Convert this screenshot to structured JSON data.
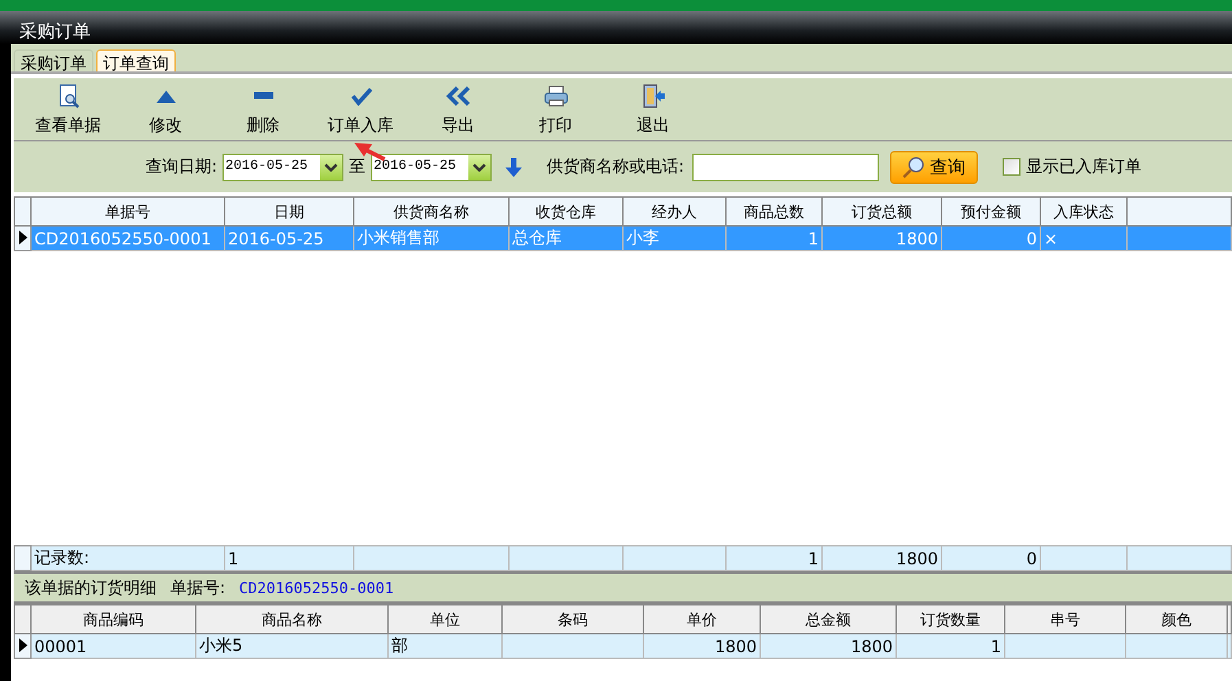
{
  "window": {
    "title": "采购订单"
  },
  "tabs": [
    {
      "label": "采购订单",
      "selected": false
    },
    {
      "label": "订单查询",
      "selected": true
    }
  ],
  "toolbar": [
    {
      "label": "查看单据",
      "kind": "view"
    },
    {
      "label": "修改",
      "kind": "edit"
    },
    {
      "label": "删除",
      "kind": "delete"
    },
    {
      "label": "订单入库",
      "kind": "check"
    },
    {
      "label": "导出",
      "kind": "export"
    },
    {
      "label": "打印",
      "kind": "print"
    },
    {
      "label": "退出",
      "kind": "exit"
    }
  ],
  "filter": {
    "date_label": "查询日期:",
    "date_from": "2016-05-25",
    "to_label": "至",
    "date_to": "2016-05-25",
    "supplier_label": "供货商名称或电话:",
    "search_button": "查询",
    "show_stocked": {
      "label": "显示已入库订单",
      "checked": false
    }
  },
  "orders": {
    "columns": [
      {
        "label": "单据号",
        "kind": "text"
      },
      {
        "label": "日期",
        "kind": "text"
      },
      {
        "label": "供货商名称",
        "kind": "text"
      },
      {
        "label": "收货仓库",
        "kind": "text"
      },
      {
        "label": "经办人",
        "kind": "text"
      },
      {
        "label": "商品总数",
        "kind": "number"
      },
      {
        "label": "订货总额",
        "kind": "number"
      },
      {
        "label": "预付金额",
        "kind": "number"
      },
      {
        "label": "入库状态",
        "kind": "text"
      }
    ],
    "rows": [
      {
        "selected": true,
        "cells": [
          "CD2016052550-0001",
          "2016-05-25",
          "小米销售部",
          "总仓库",
          "小李",
          "1",
          "1800",
          "0",
          "×"
        ]
      }
    ],
    "footer": {
      "label": "记录数:",
      "count": "1",
      "total_quantity": "1",
      "total_amount": "1800",
      "total_prepaid": "0"
    }
  },
  "detail": {
    "title": "该单据的订货明细",
    "number_label": "单据号:",
    "number": "CD2016052550-0001"
  },
  "items": {
    "columns": [
      {
        "label": "商品编码",
        "kind": "text"
      },
      {
        "label": "商品名称",
        "kind": "text"
      },
      {
        "label": "单位",
        "kind": "text"
      },
      {
        "label": "条码",
        "kind": "text"
      },
      {
        "label": "单价",
        "kind": "number"
      },
      {
        "label": "总金额",
        "kind": "number"
      },
      {
        "label": "订货数量",
        "kind": "number"
      },
      {
        "label": "串号",
        "kind": "text"
      },
      {
        "label": "颜色",
        "kind": "text"
      }
    ],
    "rows": [
      {
        "selected": true,
        "cells": [
          "00001",
          "小米5",
          "部",
          null,
          "1800",
          "1800",
          "1",
          null,
          null
        ]
      }
    ]
  }
}
